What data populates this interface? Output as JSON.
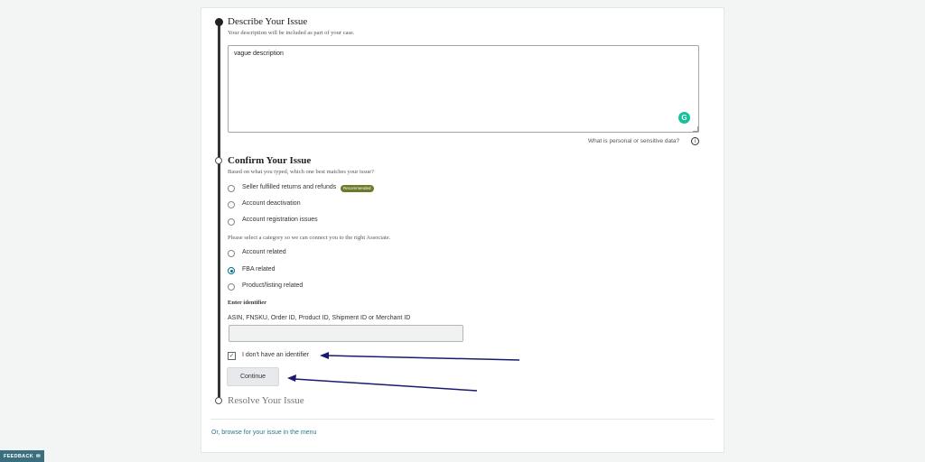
{
  "describe": {
    "title": "Describe Your Issue",
    "hint": "Your description will be included as part of your case.",
    "textarea_value": "vague description",
    "grammar_icon_glyph": "G",
    "sensitive_link": "What is personal or sensitive data?",
    "info_glyph": "i"
  },
  "confirm": {
    "title": "Confirm Your Issue",
    "question": "Based on what you typed, which one best matches your issue?",
    "options": [
      {
        "label": "Seller fulfilled returns and refunds",
        "checked": false
      },
      {
        "label": "Account deactivation",
        "checked": false
      },
      {
        "label": "Account registration issues",
        "checked": false
      }
    ],
    "recommended_badge": "Recommended",
    "category_prompt": "Please select a category so we can connect you to the right Associate.",
    "categories": [
      {
        "label": "Account related",
        "checked": false
      },
      {
        "label": "FBA related",
        "checked": true
      },
      {
        "label": "Product/listing related",
        "checked": false
      }
    ],
    "identifier_heading": "Enter identifier",
    "identifier_label": "ASIN, FNSKU, Order ID, Product ID, Shipment ID or Merchant ID",
    "identifier_value": "",
    "no_identifier_label": "I don't have an identifier",
    "no_identifier_checked": true,
    "continue_label": "Continue"
  },
  "resolve": {
    "title": "Resolve Your Issue"
  },
  "browse_link": "Or, browse for your issue in the menu",
  "feedback_tab": "FEEDBACK",
  "feedback_glyph": "✉",
  "checkmark_glyph": "✓",
  "colors": {
    "accent_teal": "#007185",
    "badge_green": "#6a7b2a",
    "arrow_navy": "#1a1a6e",
    "feedback_bg": "#3b6e7e"
  }
}
